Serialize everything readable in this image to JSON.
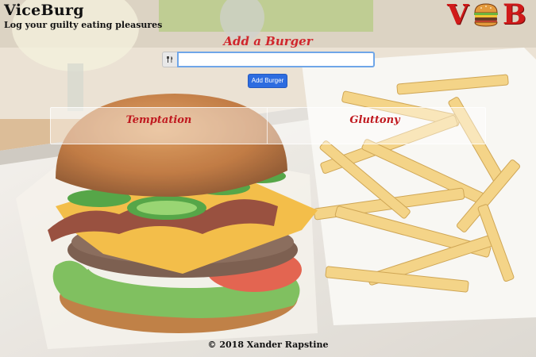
{
  "header": {
    "title": "ViceBurg",
    "tagline": "Log your guilty eating pleasures",
    "logo": {
      "left_letter": "V",
      "right_letter": "B",
      "middle_icon": "burger-icon"
    }
  },
  "form": {
    "heading": "Add a Burger",
    "input_icon": "fork-knife-icon",
    "input_value": "",
    "input_placeholder": "",
    "button_label": "Add Burger"
  },
  "columns": {
    "left_title": "Temptation",
    "right_title": "Gluttony"
  },
  "footer": {
    "copyright": "© 2018 Xander Rapstine"
  },
  "colors": {
    "accent_red": "#d0262c",
    "button_blue": "#2d6ce0",
    "input_focus": "#6fa6e8"
  }
}
